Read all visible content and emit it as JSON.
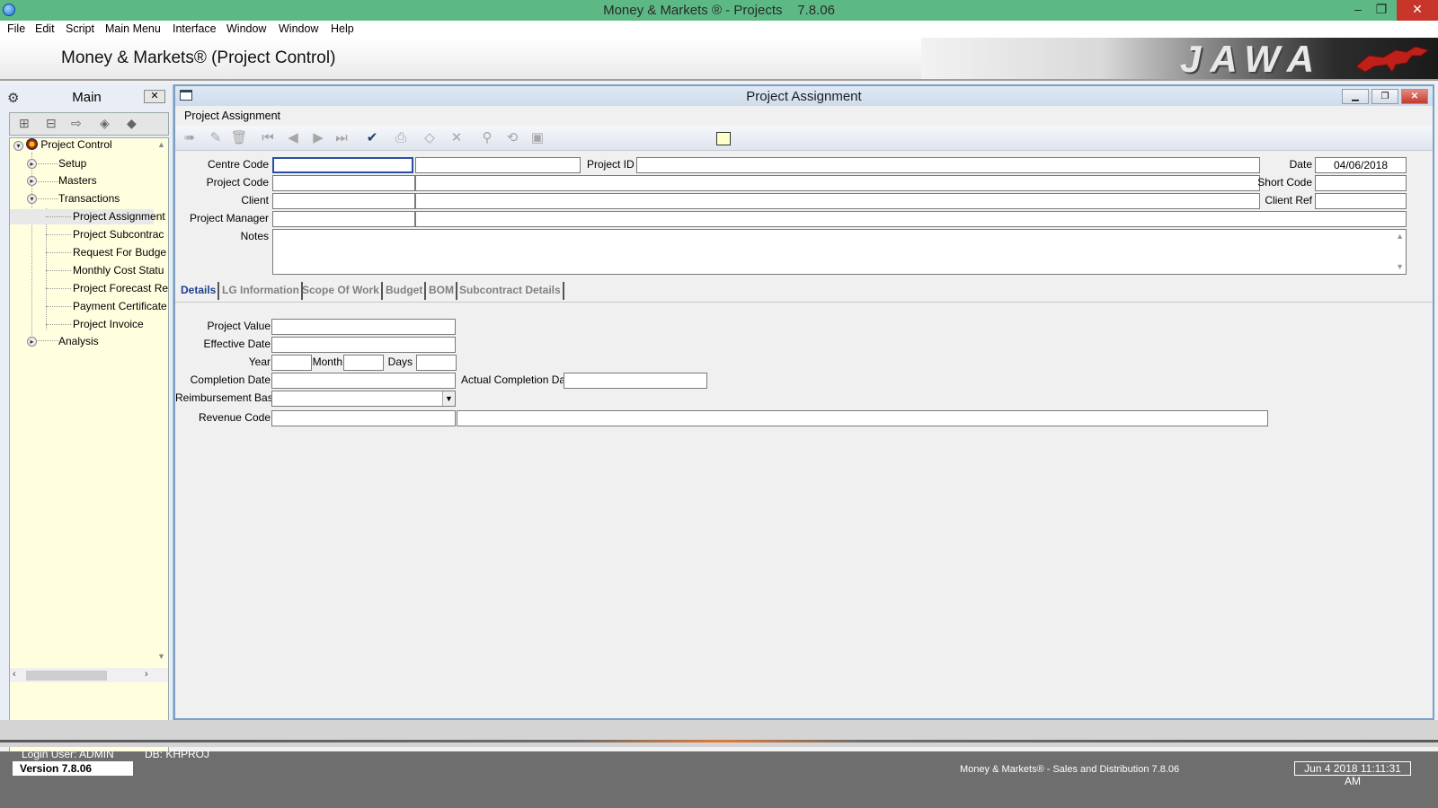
{
  "window": {
    "title": "Money & Markets ® - Projects",
    "version": "7.8.06",
    "min": "–",
    "max": "❐",
    "close": "✕"
  },
  "menu": [
    "File",
    "Edit",
    "Script",
    "Main Menu",
    "Interface",
    "Window",
    "Window",
    "Help"
  ],
  "header": {
    "app_title": "Money & Markets® (Project Control)",
    "logo_text": "JAWA"
  },
  "left_panel": {
    "title": "Main",
    "close": "✕",
    "tree": {
      "root": "Project Control",
      "items": [
        {
          "label": "Setup"
        },
        {
          "label": "Masters"
        },
        {
          "label": "Transactions"
        },
        {
          "label": "Project Assignment"
        },
        {
          "label": "Project Subcontrac"
        },
        {
          "label": "Request For Budge"
        },
        {
          "label": "Monthly Cost Statu"
        },
        {
          "label": "Project Forecast Re"
        },
        {
          "label": "Payment Certificate"
        },
        {
          "label": "Project Invoice"
        },
        {
          "label": "Analysis"
        }
      ]
    }
  },
  "child_window": {
    "title": "Project Assignment",
    "sub_title": "Project Assignment",
    "buttons": {
      "min": "▁",
      "restore": "❐",
      "close": "✕"
    }
  },
  "form": {
    "centre_code_label": "Centre Code",
    "project_code_label": "Project Code",
    "client_label": "Client",
    "project_manager_label": "Project Manager",
    "notes_label": "Notes",
    "project_id_label": "Project ID",
    "date_label": "Date",
    "date_value": "04/06/2018",
    "short_code_label": "Short Code",
    "client_ref_label": "Client Ref"
  },
  "tabs": [
    "Details",
    "LG Information",
    "Scope Of Work",
    "Budget",
    "BOM",
    "Subcontract Details"
  ],
  "details": {
    "project_value_label": "Project Value",
    "effective_date_label": "Effective Date",
    "year_label": "Year",
    "month_label": "Month",
    "days_label": "Days",
    "completion_date_label": "Completion Date",
    "actual_completion_date_label": "Actual Completion Date",
    "reimbursement_basis_label": "Reimbursement Basis",
    "revenue_code_label": "Revenue Code"
  },
  "status": {
    "login_user": "Login User: ADMIN",
    "db": "DB: KHPROJ",
    "version": "Version 7.8.06",
    "product": "Money & Markets® - Sales and Distribution  7.8.06",
    "datetime": "Jun 4 2018  11:11:31 AM"
  }
}
